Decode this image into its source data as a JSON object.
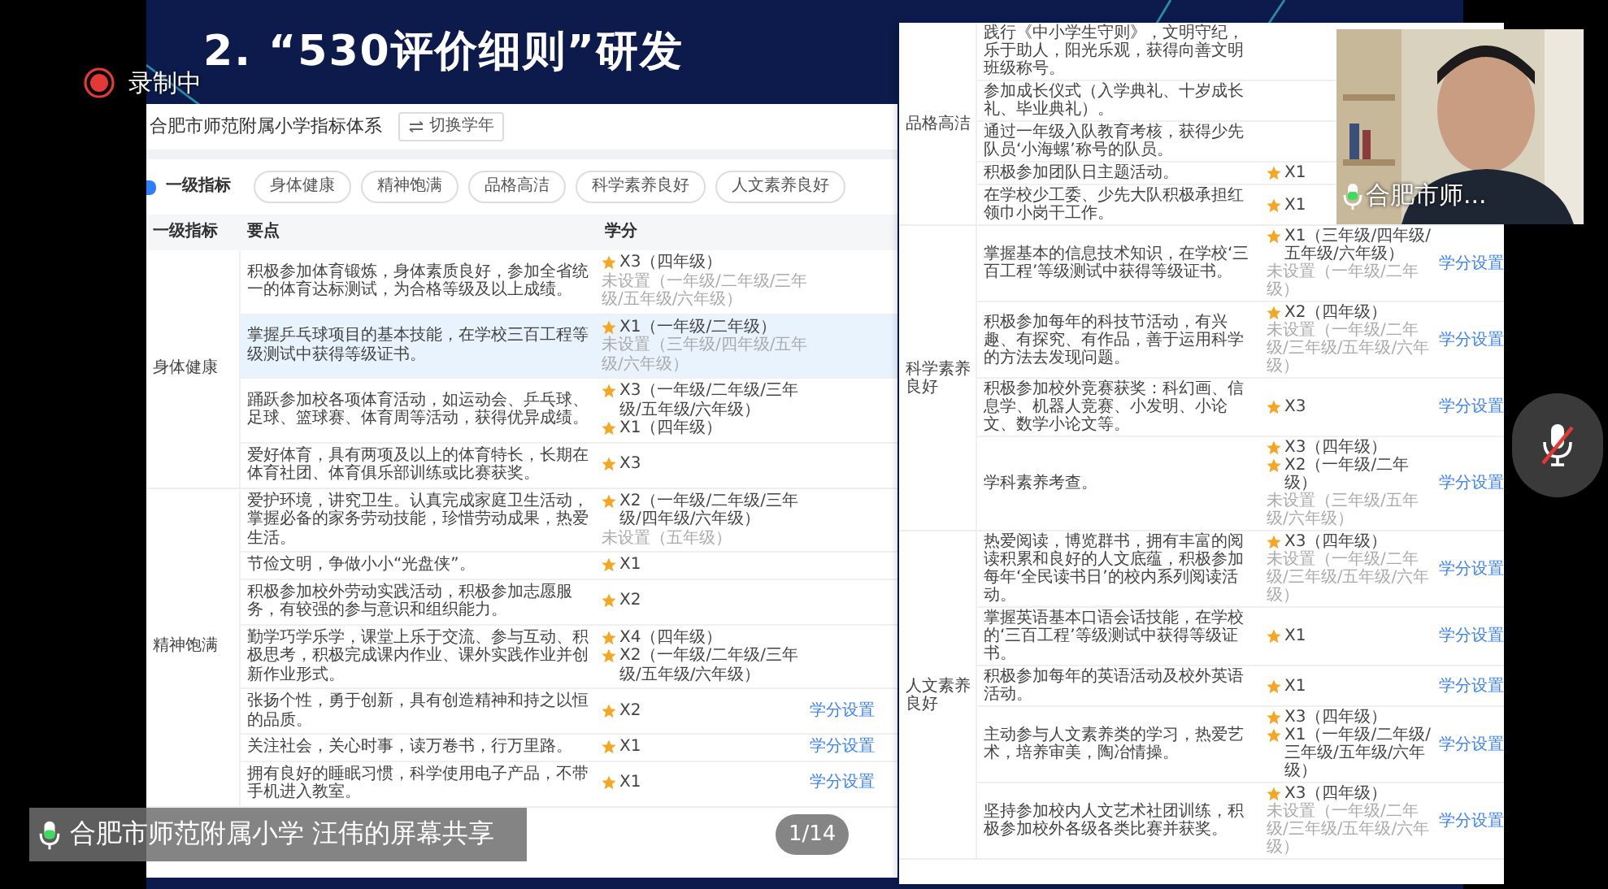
{
  "recording": {
    "label": "录制中"
  },
  "slide": {
    "title": "2. “530评价细则”研发"
  },
  "left_panel": {
    "title": "合肥市师范附属小学指标体系",
    "switch_button": "切换学年",
    "filter_label": "一级指标",
    "filter_chips": [
      {
        "label": "身体健康",
        "selected": false
      },
      {
        "label": "精神饱满",
        "selected": false
      },
      {
        "label": "品格高洁",
        "selected": false
      },
      {
        "label": "科学素养良好",
        "selected": false
      },
      {
        "label": "人文素养良好",
        "selected": false
      }
    ],
    "columns": [
      "一级指标",
      "要点",
      "学分"
    ],
    "groups": [
      {
        "name": "身体健康",
        "rows": [
          {
            "text": "积极参加体育锻炼，身体素质良好，参加全省统一的体育达标测试，为合格等级及以上成绩。",
            "highlighted": false,
            "credits": [
              {
                "kind": "star",
                "text": "X3（四年级）"
              },
              {
                "kind": "unset",
                "text": "未设置（一年级/二年级/三年级/五年级/六年级）"
              }
            ]
          },
          {
            "text": "掌握乒乓球项目的基本技能，在学校三百工程等级测试中获得等级证书。",
            "highlighted": true,
            "credits": [
              {
                "kind": "star",
                "text": "X1（一年级/二年级）"
              },
              {
                "kind": "unset",
                "text": "未设置（三年级/四年级/五年级/六年级）"
              }
            ]
          },
          {
            "text": "踊跃参加校各项体育活动，如运动会、乒乓球、足球、篮球赛、体育周等活动，获得优异成绩。",
            "highlighted": false,
            "credits": [
              {
                "kind": "star",
                "text": "X3（一年级/二年级/三年级/五年级/六年级）"
              },
              {
                "kind": "star",
                "text": "X1（四年级）"
              }
            ]
          },
          {
            "text": "爱好体育，具有两项及以上的体育特长，长期在体育社团、体育俱乐部训练或比赛获奖。",
            "highlighted": false,
            "credits": [
              {
                "kind": "star",
                "text": "X3"
              }
            ]
          }
        ]
      },
      {
        "name": "精神饱满",
        "rows": [
          {
            "text": "爱护环境，讲究卫生。认真完成家庭卫生活动，掌握必备的家务劳动技能，珍惜劳动成果，热爱生活。",
            "highlighted": false,
            "credits": [
              {
                "kind": "star",
                "text": "X2（一年级/二年级/三年级/四年级/六年级）"
              },
              {
                "kind": "unset",
                "text": "未设置（五年级）"
              }
            ]
          },
          {
            "text": "节俭文明，争做小小“光盘侠”。",
            "highlighted": false,
            "credits": [
              {
                "kind": "star",
                "text": "X1"
              }
            ]
          },
          {
            "text": "积极参加校外劳动实践活动，积极参加志愿服务，有较强的参与意识和组织能力。",
            "highlighted": false,
            "credits": [
              {
                "kind": "star",
                "text": "X2"
              }
            ]
          },
          {
            "text": "勤学巧学乐学，课堂上乐于交流、参与互动、积极思考，积极完成课内作业、课外实践作业并创新作业形式。",
            "highlighted": false,
            "credits": [
              {
                "kind": "star",
                "text": "X4（四年级）"
              },
              {
                "kind": "star",
                "text": "X2（一年级/二年级/三年级/五年级/六年级）"
              }
            ]
          },
          {
            "text": "张扬个性，勇于创新，具有创造精神和持之以恒的品质。",
            "highlighted": false,
            "credits": [
              {
                "kind": "star",
                "text": "X2"
              }
            ],
            "action": "学分设置"
          },
          {
            "text": "关注社会，关心时事，读万卷书，行万里路。",
            "highlighted": false,
            "credits": [
              {
                "kind": "star",
                "text": "X1"
              }
            ],
            "action": "学分设置"
          },
          {
            "text": "拥有良好的睡眠习惯，科学使用电子产品，不带手机进入教室。",
            "highlighted": false,
            "credits": [
              {
                "kind": "star",
                "text": "X1"
              }
            ],
            "action": "学分设置"
          }
        ]
      }
    ]
  },
  "right_panel": {
    "groups": [
      {
        "name": "品格高洁",
        "rows": [
          {
            "text": "践行《中小学生守则》，文明守纪，乐于助人，阳光乐观，获得向善文明班级称号。",
            "highlighted": false,
            "credits": []
          },
          {
            "text": "参加成长仪式（入学典礼、十岁成长礼、毕业典礼）。",
            "highlighted": false,
            "credits": []
          },
          {
            "text": "通过一年级入队教育考核，获得少先队员‘小海螺’称号的队员。",
            "highlighted": false,
            "credits": []
          },
          {
            "text": "积极参加团队日主题活动。",
            "highlighted": false,
            "credits": [
              {
                "kind": "star",
                "text": "X1"
              }
            ]
          },
          {
            "text": "在学校少工委、少先大队积极承担红领巾小岗干工作。",
            "highlighted": false,
            "credits": [
              {
                "kind": "star",
                "text": "X1"
              }
            ]
          }
        ]
      },
      {
        "name": "科学素养良好",
        "rows": [
          {
            "text": "掌握基本的信息技术知识，在学校‘三百工程’等级测试中获得等级证书。",
            "highlighted": false,
            "credits": [
              {
                "kind": "star",
                "text": "X1（三年级/四年级/五年级/六年级）"
              },
              {
                "kind": "unset",
                "text": "未设置（一年级/二年级）"
              }
            ],
            "action": "学分设置"
          },
          {
            "text": "积极参加每年的科技节活动，有兴趣、有探究、有作品，善于运用科学的方法去发现问题。",
            "highlighted": false,
            "credits": [
              {
                "kind": "star",
                "text": "X2（四年级）"
              },
              {
                "kind": "unset",
                "text": "未设置（一年级/二年级/三年级/五年级/六年级）"
              }
            ],
            "action": "学分设置"
          },
          {
            "text": "积极参加校外竞赛获奖：科幻画、信息学、机器人竞赛、小发明、小论文、数学小论文等。",
            "highlighted": false,
            "credits": [
              {
                "kind": "star",
                "text": "X3"
              }
            ],
            "action": "学分设置"
          },
          {
            "text": "学科素养考查。",
            "highlighted": false,
            "credits": [
              {
                "kind": "star",
                "text": "X3（四年级）"
              },
              {
                "kind": "star",
                "text": "X2（一年级/二年级）"
              },
              {
                "kind": "unset",
                "text": "未设置（三年级/五年级/六年级）"
              }
            ],
            "action": "学分设置"
          }
        ]
      },
      {
        "name": "人文素养良好",
        "rows": [
          {
            "text": "热爱阅读，博览群书，拥有丰富的阅读积累和良好的人文底蕴，积极参加每年‘全民读书日’的校内系列阅读活动。",
            "highlighted": false,
            "credits": [
              {
                "kind": "star",
                "text": "X3（四年级）"
              },
              {
                "kind": "unset",
                "text": "未设置（一年级/二年级/三年级/五年级/六年级）"
              }
            ],
            "action": "学分设置"
          },
          {
            "text": "掌握英语基本口语会话技能，在学校的‘三百工程’等级测试中获得等级证书。",
            "highlighted": false,
            "credits": [
              {
                "kind": "star",
                "text": "X1"
              }
            ],
            "action": "学分设置"
          },
          {
            "text": "积极参加每年的英语活动及校外英语活动。",
            "highlighted": false,
            "credits": [
              {
                "kind": "star",
                "text": "X1"
              }
            ],
            "action": "学分设置"
          },
          {
            "text": "主动参与人文素养类的学习，热爱艺术，培养审美，陶冶情操。",
            "highlighted": false,
            "credits": [
              {
                "kind": "star",
                "text": "X3（四年级）"
              },
              {
                "kind": "star",
                "text": "X1（一年级/二年级/三年级/五年级/六年级）"
              }
            ],
            "action": "学分设置"
          },
          {
            "text": "坚持参加校内人文艺术社团训练，积极参加校外各级各类比赛并获奖。",
            "highlighted": false,
            "credits": [
              {
                "kind": "star",
                "text": "X3（四年级）"
              },
              {
                "kind": "unset",
                "text": "未设置（一年级/二年级/三年级/五年级/六年级）"
              }
            ],
            "action": "学分设置"
          }
        ]
      }
    ]
  },
  "webcam": {
    "name_label": "合肥市师..."
  },
  "share_caption": {
    "label": "合肥市师范附属小学 汪伟的屏幕共享"
  },
  "page_counter": "1/14"
}
